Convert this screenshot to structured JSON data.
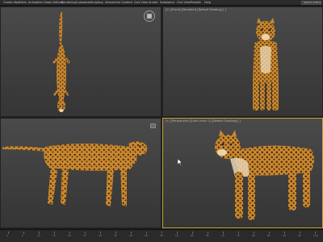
{
  "menubar": {
    "items": [
      "Create",
      "Modifiers",
      "Animation",
      "Graph Editors",
      "Rendering",
      "Customize",
      "Scripting",
      "Interactive",
      "Content",
      "Civil View",
      "Arnold",
      "Substance",
      "Civil View",
      "Presets",
      "Help"
    ],
    "search_text": "Search Actions"
  },
  "viewports": {
    "top_left": {
      "label": ""
    },
    "top_right": {
      "label": "[+] [Front] [Standard] [Default Shading] [ ]"
    },
    "bottom_left": {
      "label": ""
    },
    "bottom_right": {
      "label": "[+] [Perspective] [User Level: 2] [Default Shading] [ ]"
    }
  },
  "timeline": {
    "ticks": [
      "0",
      "5",
      "10",
      "15",
      "20",
      "25",
      "30",
      "35",
      "40",
      "45",
      "50",
      "55",
      "60",
      "65",
      "70",
      "75",
      "80",
      "85",
      "90",
      "95",
      "100"
    ]
  },
  "colors": {
    "viewport_bg_top": "#4a4a4a",
    "viewport_bg_bottom": "#353535",
    "active_border": "#c9a227",
    "leopard_fur": "#c8872f",
    "leopard_spot": "#3a2410"
  }
}
